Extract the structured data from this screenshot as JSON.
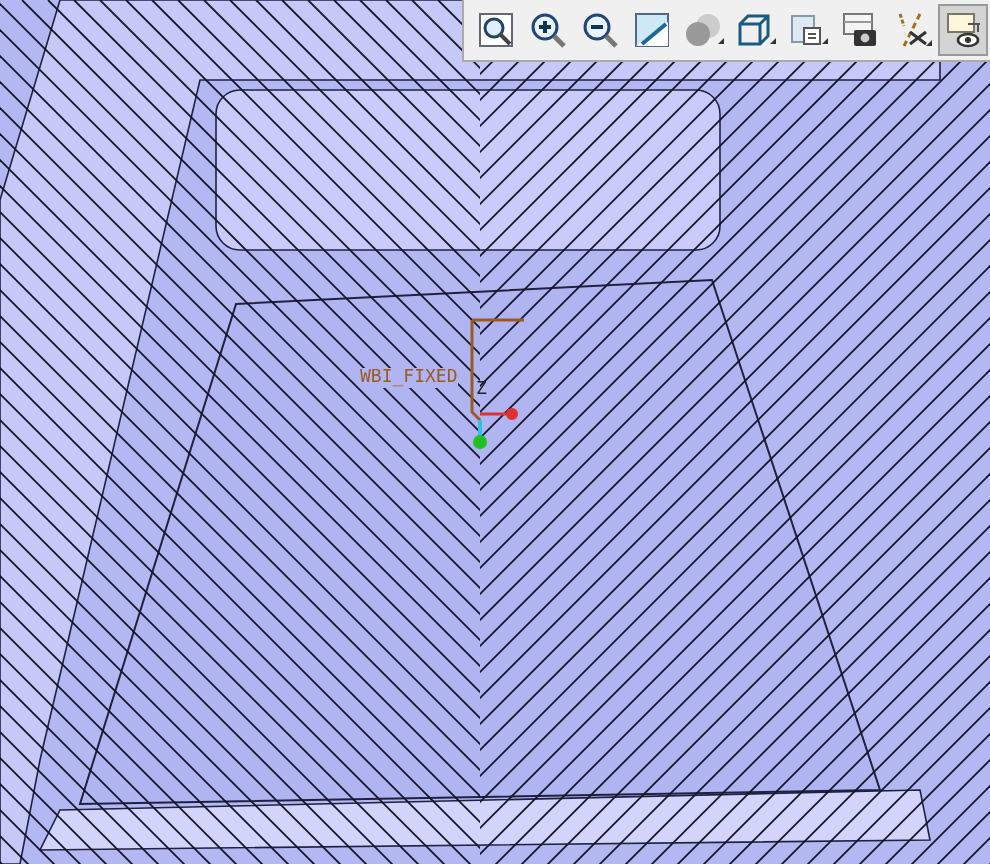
{
  "toolbar": [
    {
      "kind": "zoom-window",
      "selected": false
    },
    {
      "kind": "zoom-in",
      "selected": false
    },
    {
      "kind": "zoom-out",
      "selected": false
    },
    {
      "kind": "repaint",
      "selected": false
    },
    {
      "kind": "shading",
      "selected": false
    },
    {
      "kind": "view-cube",
      "selected": false
    },
    {
      "kind": "saved-views",
      "selected": false
    },
    {
      "kind": "camera",
      "selected": false
    },
    {
      "kind": "datum",
      "selected": false
    },
    {
      "kind": "display",
      "selected": true
    }
  ],
  "csys": {
    "name": "WBI_FIXED",
    "axis": "Z"
  }
}
